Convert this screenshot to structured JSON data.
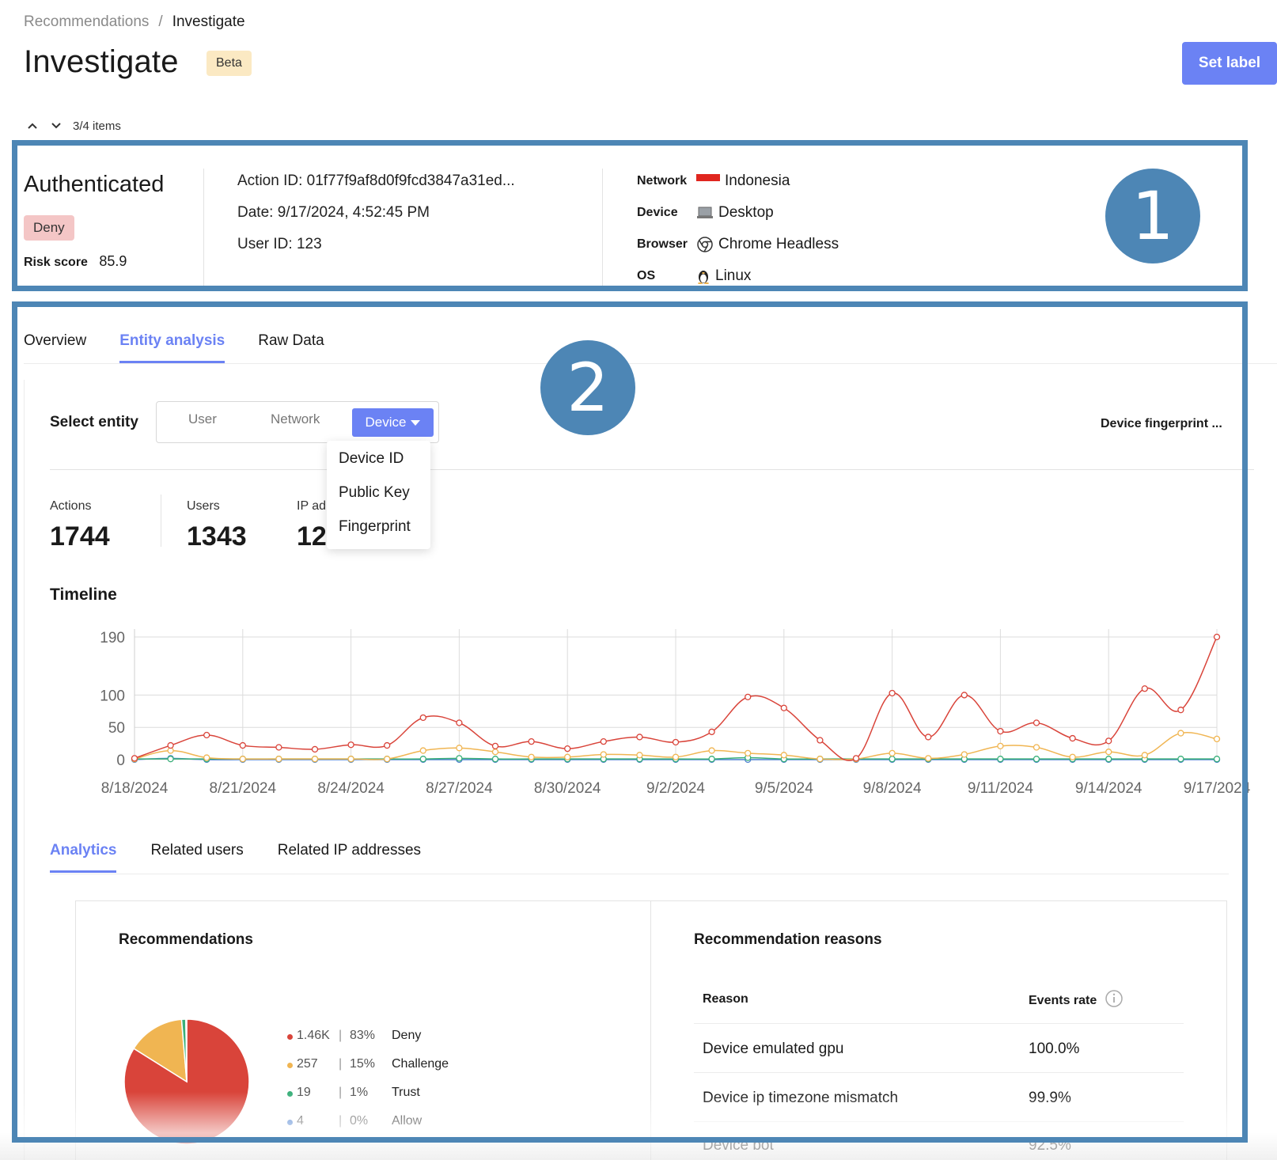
{
  "breadcrumb": {
    "parent": "Recommendations",
    "separator": "/",
    "current": "Investigate"
  },
  "header": {
    "title": "Investigate",
    "badge": "Beta",
    "set_label_button": "Set label"
  },
  "pager": {
    "text": "3/4 items"
  },
  "annotations": {
    "step1": "1",
    "step2": "2",
    "frame_color": "#4d86b5"
  },
  "summary": {
    "status": "Authenticated",
    "decision": "Deny",
    "risk_label": "Risk score",
    "risk_value": "85.9",
    "action_id": "Action ID: 01f77f9af8d0f9fcd3847a31ed...",
    "date": "Date: 9/17/2024, 4:52:45 PM",
    "user_id": "User ID: 123",
    "network_label": "Network",
    "network_value": "Indonesia",
    "network_icon": "indonesia-flag-icon",
    "device_label": "Device",
    "device_value": "Desktop",
    "device_icon": "laptop-icon",
    "browser_label": "Browser",
    "browser_value": "Chrome Headless",
    "browser_icon": "chrome-icon",
    "os_label": "OS",
    "os_value": "Linux",
    "os_icon": "linux-penguin-icon"
  },
  "tabs": [
    "Overview",
    "Entity analysis",
    "Raw Data"
  ],
  "active_tab": "Entity analysis",
  "entity": {
    "label": "Select entity",
    "options": [
      "User",
      "Network",
      "Device"
    ],
    "selected": "Device",
    "dropdown": [
      "Device ID",
      "Public Key",
      "Fingerprint"
    ],
    "fingerprint_label": "Device fingerprint ..."
  },
  "stats": [
    {
      "label": "Actions",
      "value": "1744"
    },
    {
      "label": "Users",
      "value": "1343"
    },
    {
      "label": "IP ad",
      "value": "12"
    }
  ],
  "timeline_title": "Timeline",
  "chart_data": {
    "type": "line",
    "title": "Timeline",
    "x": [
      "8/18/2024",
      "8/19/2024",
      "8/20/2024",
      "8/21/2024",
      "8/22/2024",
      "8/23/2024",
      "8/24/2024",
      "8/25/2024",
      "8/26/2024",
      "8/27/2024",
      "8/28/2024",
      "8/29/2024",
      "8/30/2024",
      "8/31/2024",
      "9/1/2024",
      "9/2/2024",
      "9/3/2024",
      "9/4/2024",
      "9/5/2024",
      "9/6/2024",
      "9/7/2024",
      "9/8/2024",
      "9/9/2024",
      "9/10/2024",
      "9/11/2024",
      "9/12/2024",
      "9/13/2024",
      "9/14/2024",
      "9/15/2024",
      "9/16/2024",
      "9/17/2024"
    ],
    "x_tick_labels": [
      "8/18/2024",
      "8/21/2024",
      "8/24/2024",
      "8/27/2024",
      "8/30/2024",
      "9/2/2024",
      "9/5/2024",
      "9/8/2024",
      "9/11/2024",
      "9/14/2024",
      "9/17/2024"
    ],
    "y_ticks": [
      0,
      50,
      100,
      190
    ],
    "ylim": [
      0,
      190
    ],
    "grid": true,
    "series": [
      {
        "color": "#d9443a",
        "values": [
          2,
          22,
          38,
          22,
          19,
          16,
          23,
          22,
          65,
          57,
          21,
          28,
          17,
          28,
          35,
          27,
          43,
          97,
          80,
          30,
          2,
          103,
          35,
          100,
          44,
          57,
          33,
          29,
          110,
          77,
          190
        ]
      },
      {
        "color": "#f0b552",
        "values": [
          1,
          14,
          3,
          1,
          1,
          1,
          1,
          1,
          14,
          18,
          12,
          4,
          4,
          8,
          7,
          4,
          14,
          10,
          7,
          1,
          1,
          10,
          2,
          8,
          21,
          19,
          4,
          12,
          7,
          41,
          32
        ]
      },
      {
        "color": "#3aaf7a",
        "values": [
          1,
          1,
          1,
          1,
          1,
          1,
          1,
          1,
          1,
          2,
          1,
          1,
          1,
          1,
          1,
          1,
          1,
          3,
          1,
          1,
          1,
          1,
          1,
          1,
          1,
          1,
          1,
          1,
          1,
          1,
          1
        ]
      },
      {
        "color": "#4a7fd0",
        "values": [
          0,
          2,
          0,
          0,
          0,
          0,
          0,
          0,
          0,
          0,
          0,
          0,
          0,
          0,
          0,
          0,
          0,
          0,
          0,
          0,
          0,
          0,
          0,
          0,
          0,
          0,
          0,
          0,
          0,
          0,
          0
        ]
      }
    ]
  },
  "subtabs": [
    "Analytics",
    "Related users",
    "Related IP addresses"
  ],
  "active_subtab": "Analytics",
  "recommendations": {
    "title": "Recommendations",
    "items": [
      {
        "count": "1.46K",
        "pct": "83%",
        "name": "Deny",
        "color": "#d9443a",
        "value": 1460
      },
      {
        "count": "257",
        "pct": "15%",
        "name": "Challenge",
        "color": "#f0b552",
        "value": 257
      },
      {
        "count": "19",
        "pct": "1%",
        "name": "Trust",
        "color": "#3aaf7a",
        "value": 19
      },
      {
        "count": "4",
        "pct": "0%",
        "name": "Allow",
        "color": "#4a7fd0",
        "value": 4
      }
    ]
  },
  "reasons": {
    "title": "Recommendation reasons",
    "col_reason": "Reason",
    "col_rate": "Events rate",
    "rows": [
      {
        "reason": "Device emulated gpu",
        "rate": "100.0%"
      },
      {
        "reason": "Device ip timezone mismatch",
        "rate": "99.9%"
      },
      {
        "reason": "Device bot",
        "rate": "92.5%"
      }
    ]
  }
}
